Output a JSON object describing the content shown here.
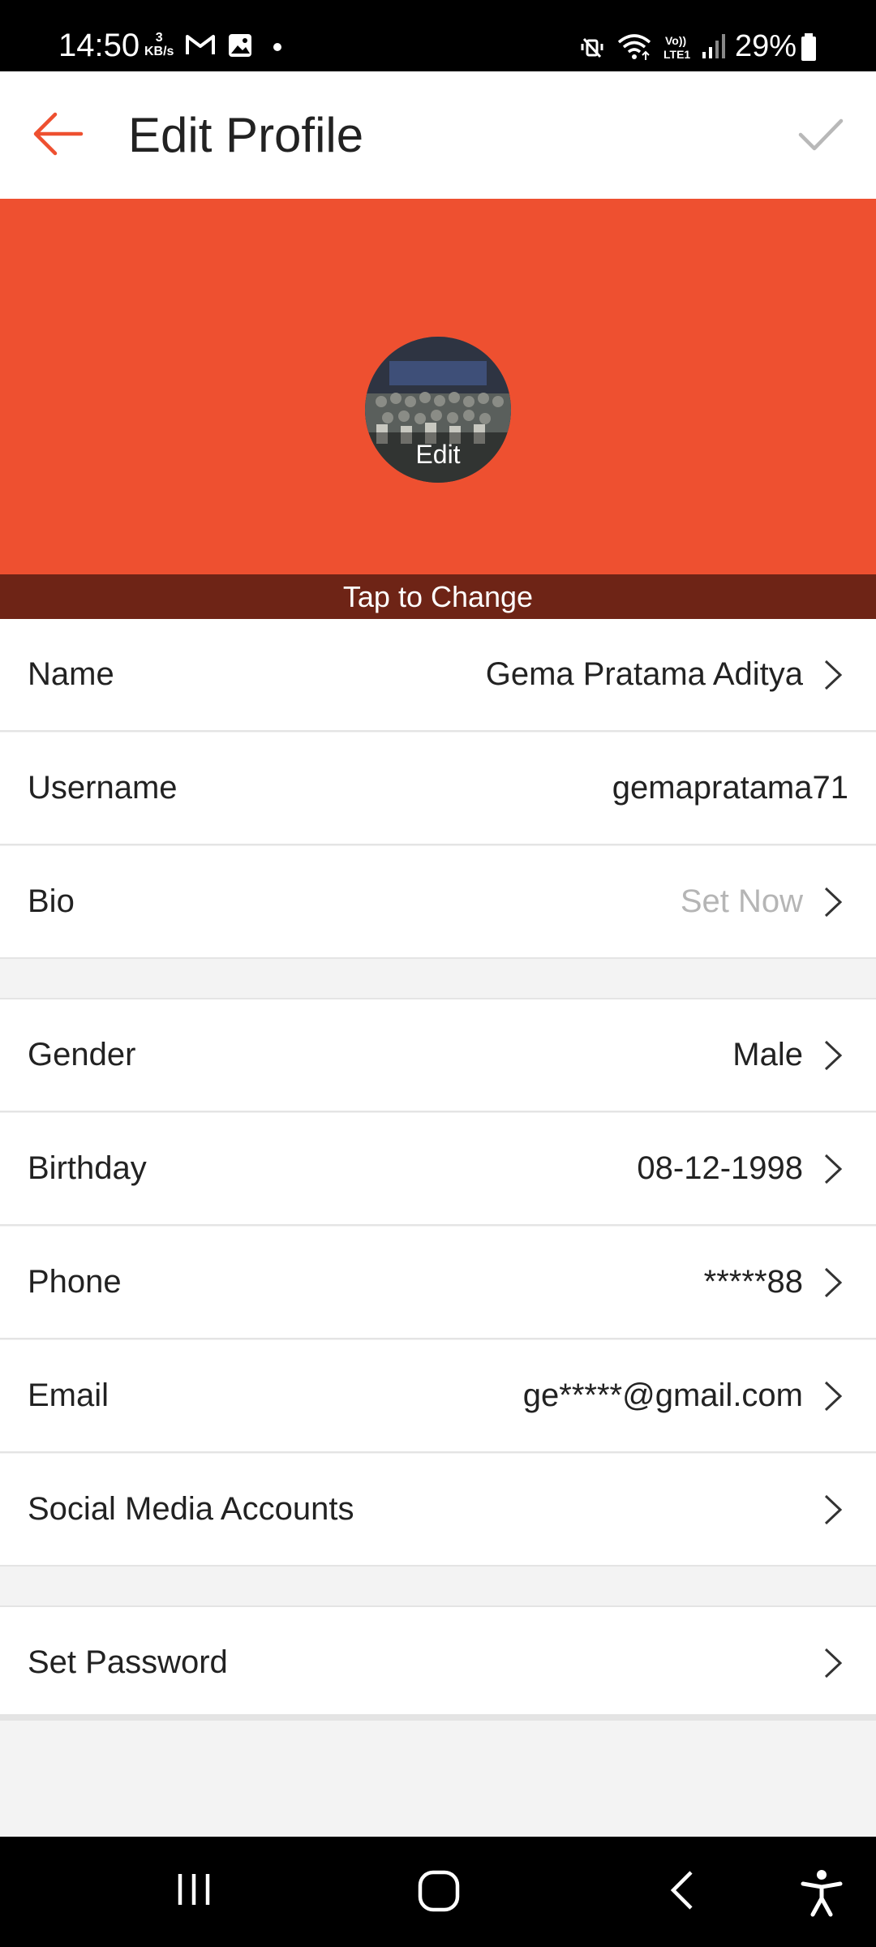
{
  "status_bar": {
    "time": "14:50",
    "speed_value": "3",
    "speed_unit": "KB/s",
    "battery": "29%",
    "icons": [
      "gmail-icon",
      "gallery-icon",
      "dot-icon",
      "mute-icon",
      "wifi-icon",
      "volte-icon",
      "signal-icon",
      "battery-icon"
    ]
  },
  "header": {
    "title": "Edit Profile",
    "back_icon": "arrow-left-icon",
    "confirm_icon": "checkmark-icon"
  },
  "cover": {
    "avatar_edit_label": "Edit",
    "tap_to_change": "Tap to Change"
  },
  "fields": [
    {
      "label": "Name",
      "value": "Gema Pratama Aditya"
    },
    {
      "label": "Username",
      "value": "gemapratama71"
    },
    {
      "label": "Bio",
      "value": "Set Now"
    },
    {
      "label": "Gender",
      "value": "Male"
    },
    {
      "label": "Birthday",
      "value": "08-12-1998"
    },
    {
      "label": "Phone",
      "value": "*****88"
    },
    {
      "label": "Email",
      "value": "ge*****@gmail.com"
    },
    {
      "label": "Social Media Accounts",
      "value": ""
    },
    {
      "label": "Set Password",
      "value": ""
    }
  ],
  "colors": {
    "accent": "#ee5030",
    "band": "#6e2416"
  },
  "nav_bar": {
    "icons": [
      "recents-icon",
      "home-icon",
      "back-icon",
      "accessibility-icon"
    ]
  }
}
